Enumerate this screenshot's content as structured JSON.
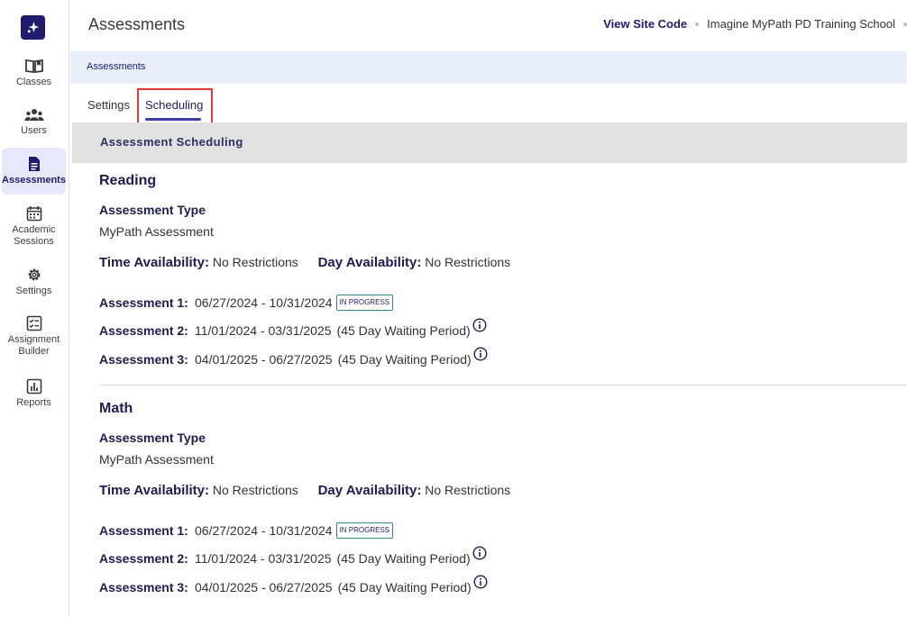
{
  "sidebar": {
    "logo": "sparkle-logo",
    "items": [
      {
        "label": "Classes",
        "icon": "book-icon"
      },
      {
        "label": "Users",
        "icon": "users-icon"
      },
      {
        "label": "Assessments",
        "icon": "document-icon"
      },
      {
        "label": "Academic Sessions",
        "icon": "calendar-icon"
      },
      {
        "label": "Settings",
        "icon": "gear-icon"
      },
      {
        "label": "Assignment Builder",
        "icon": "checklist-icon"
      },
      {
        "label": "Reports",
        "icon": "bar-chart-icon"
      }
    ]
  },
  "header": {
    "title": "Assessments",
    "site_code_link": "View Site Code",
    "school_name": "Imagine MyPath PD Training School"
  },
  "breadcrumb": "Assessments",
  "tabs": [
    {
      "label": "Settings",
      "active": false
    },
    {
      "label": "Scheduling",
      "active": true
    }
  ],
  "section_title": "Assessment Scheduling",
  "subjects": [
    {
      "name": "Reading",
      "type_label": "Assessment Type",
      "type_value": "MyPath Assessment",
      "time_label": "Time Availability:",
      "time_value": "No Restrictions",
      "day_label": "Day Availability:",
      "day_value": "No Restrictions",
      "assessments": [
        {
          "label": "Assessment 1:",
          "dates": "06/27/2024 - 10/31/2024",
          "status": "IN PROGRESS"
        },
        {
          "label": "Assessment 2:",
          "dates": "11/01/2024 - 03/31/2025",
          "note": "(45 Day Waiting Period)"
        },
        {
          "label": "Assessment 3:",
          "dates": "04/01/2025 - 06/27/2025",
          "note": "(45 Day Waiting Period)"
        }
      ]
    },
    {
      "name": "Math",
      "type_label": "Assessment Type",
      "type_value": "MyPath Assessment",
      "time_label": "Time Availability:",
      "time_value": "No Restrictions",
      "day_label": "Day Availability:",
      "day_value": "No Restrictions",
      "assessments": [
        {
          "label": "Assessment 1:",
          "dates": "06/27/2024 - 10/31/2024",
          "status": "IN PROGRESS"
        },
        {
          "label": "Assessment 2:",
          "dates": "11/01/2024 - 03/31/2025",
          "note": "(45 Day Waiting Period)"
        },
        {
          "label": "Assessment 3:",
          "dates": "04/01/2025 - 06/27/2025",
          "note": "(45 Day Waiting Period)"
        }
      ]
    }
  ],
  "colors": {
    "brand": "#1f1c6e",
    "active_nav_bg": "#e7e9fb",
    "breadcrumb_bg": "#e9eefa",
    "section_header_bg": "#e2e2e2",
    "highlight": "#e53935"
  }
}
